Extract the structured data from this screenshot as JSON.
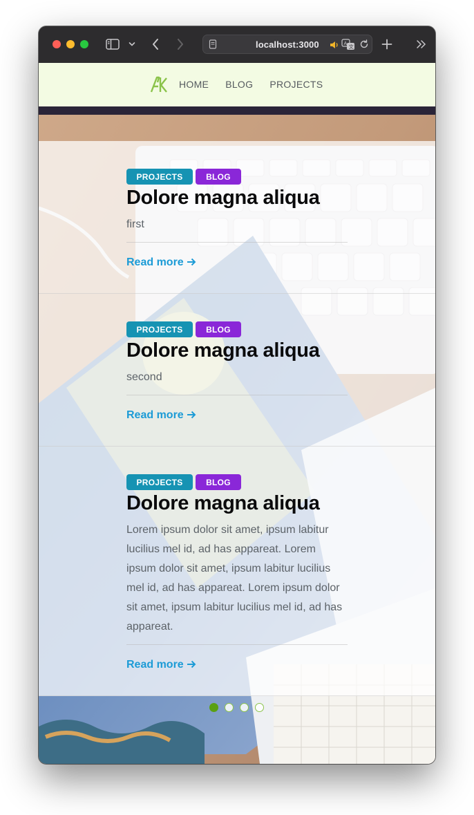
{
  "browser": {
    "url": "localhost:3000",
    "icons": [
      "sidebar-toggle-icon",
      "chevron-down-icon",
      "back-arrow-icon",
      "forward-arrow-icon",
      "page-icon",
      "audio-icon",
      "translate-icon",
      "reload-icon",
      "plus-icon",
      "double-chevron-icon"
    ]
  },
  "site": {
    "logo": "AK",
    "nav": [
      {
        "label": "HOME"
      },
      {
        "label": "BLOG"
      },
      {
        "label": "PROJECTS"
      }
    ]
  },
  "posts": [
    {
      "tags": [
        "PROJECTS",
        "BLOG"
      ],
      "title": "Dolore magna aliqua",
      "excerpt": "first",
      "read_more": "Read more"
    },
    {
      "tags": [
        "PROJECTS",
        "BLOG"
      ],
      "title": "Dolore magna aliqua",
      "excerpt": "second",
      "read_more": "Read more"
    },
    {
      "tags": [
        "PROJECTS",
        "BLOG"
      ],
      "title": "Dolore magna aliqua",
      "excerpt": "Lorem ipsum dolor sit amet, ipsum labitur lucilius mel id, ad has appareat. Lorem ipsum dolor sit amet, ipsum labitur lucilius mel id, ad has appareat. Lorem ipsum dolor sit amet, ipsum labitur lucilius mel id, ad has appareat.",
      "read_more": "Read more"
    }
  ],
  "pagination": {
    "total_pages": 4,
    "current_page": 1
  },
  "colors": {
    "header_bg": "#f3fbe3",
    "logo": "#8bc34a",
    "tag_projects": "#1693b3",
    "tag_blog": "#8a27d8",
    "link": "#1c9bd6",
    "dot_active": "#5aa013"
  }
}
